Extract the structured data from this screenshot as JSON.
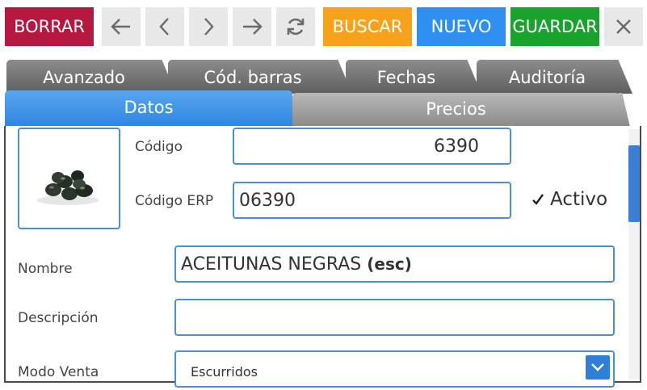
{
  "toolbar": {
    "delete_label": "BORRAR",
    "search_label": "BUSCAR",
    "new_label": "NUEVO",
    "save_label": "GUARDAR",
    "colors": {
      "delete": "#b5183e",
      "search": "#f7a21b",
      "new": "#2f8ff0",
      "save": "#19a32c",
      "nav": "#e8e8e8"
    }
  },
  "tabs": {
    "row1": [
      "Avanzado",
      "Cód. barras",
      "Fechas",
      "Auditoría"
    ],
    "row2": [
      "Datos",
      "Precios"
    ],
    "active": "Datos"
  },
  "form": {
    "code_label": "Código",
    "code_value": "6390",
    "erp_label": "Código ERP",
    "erp_value": "06390",
    "active_label": "Activo",
    "active_checked": true,
    "name_label": "Nombre",
    "name_value": "ACEITUNAS NEGRAS",
    "name_suffix": "(esc)",
    "description_label": "Descripción",
    "description_value": "",
    "sale_mode_label": "Modo Venta",
    "sale_mode_value": "Escurridos"
  },
  "icons": [
    "arrow-left-icon",
    "chevron-left-icon",
    "chevron-right-icon",
    "arrow-right-icon",
    "refresh-icon",
    "close-icon",
    "check-icon",
    "chevron-down-icon",
    "product-image"
  ]
}
